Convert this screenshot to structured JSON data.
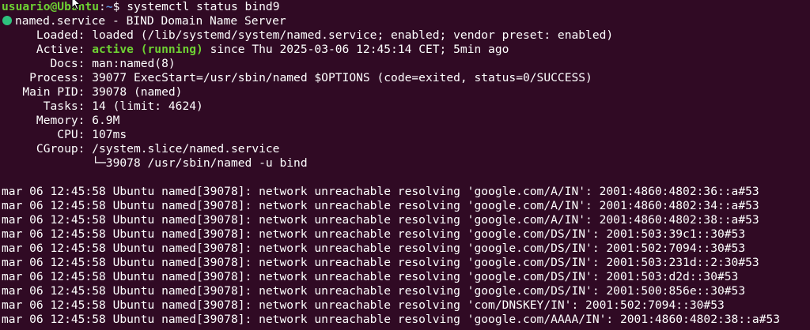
{
  "prompt": {
    "user_host": "usuario@Ubuntu",
    "sep": ":",
    "path": "~",
    "symbol": "$ ",
    "command": "systemctl status bind9"
  },
  "service": {
    "header": "named.service - BIND Domain Name Server",
    "status_color": "#2ec27e",
    "fields": [
      {
        "label": "     Loaded: ",
        "value": "loaded (/lib/systemd/system/named.service; enabled; vendor preset: enabled)"
      },
      {
        "label": "     Active: ",
        "state": "active (running)",
        "value": " since Thu 2025-03-06 12:45:14 CET; 5min ago"
      },
      {
        "label": "       Docs: ",
        "value": "man:named(8)"
      },
      {
        "label": "    Process: ",
        "value": "39077 ExecStart=/usr/sbin/named $OPTIONS (code=exited, status=0/SUCCESS)"
      },
      {
        "label": "   Main PID: ",
        "value": "39078 (named)"
      },
      {
        "label": "      Tasks: ",
        "value": "14 (limit: 4624)"
      },
      {
        "label": "     Memory: ",
        "value": "6.9M"
      },
      {
        "label": "        CPU: ",
        "value": "107ms"
      },
      {
        "label": "     CGroup: ",
        "value": "/system.slice/named.service"
      },
      {
        "label": "             ",
        "value": "└─39078 /usr/sbin/named -u bind"
      }
    ]
  },
  "log_lines": [
    "mar 06 12:45:58 Ubuntu named[39078]: network unreachable resolving 'google.com/A/IN': 2001:4860:4802:36::a#53",
    "mar 06 12:45:58 Ubuntu named[39078]: network unreachable resolving 'google.com/A/IN': 2001:4860:4802:34::a#53",
    "mar 06 12:45:58 Ubuntu named[39078]: network unreachable resolving 'google.com/A/IN': 2001:4860:4802:38::a#53",
    "mar 06 12:45:58 Ubuntu named[39078]: network unreachable resolving 'google.com/DS/IN': 2001:503:39c1::30#53",
    "mar 06 12:45:58 Ubuntu named[39078]: network unreachable resolving 'google.com/DS/IN': 2001:502:7094::30#53",
    "mar 06 12:45:58 Ubuntu named[39078]: network unreachable resolving 'google.com/DS/IN': 2001:503:231d::2:30#53",
    "mar 06 12:45:58 Ubuntu named[39078]: network unreachable resolving 'google.com/DS/IN': 2001:503:d2d::30#53",
    "mar 06 12:45:58 Ubuntu named[39078]: network unreachable resolving 'google.com/DS/IN': 2001:500:856e::30#53",
    "mar 06 12:45:58 Ubuntu named[39078]: network unreachable resolving 'com/DNSKEY/IN': 2001:502:7094::30#53",
    "mar 06 12:45:58 Ubuntu named[39078]: network unreachable resolving 'google.com/AAAA/IN': 2001:4860:4802:38::a#53"
  ]
}
